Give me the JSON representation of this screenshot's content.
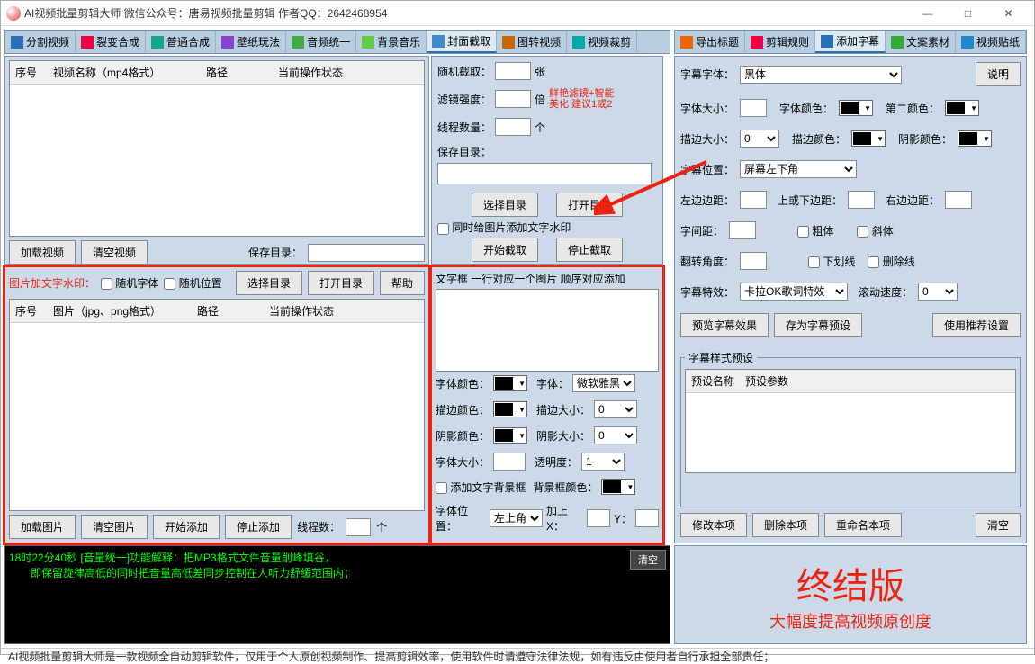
{
  "window": {
    "title": "AI视频批量剪辑大师   微信公众号：唐易视频批量剪辑   作者QQ：2642468954",
    "min": "—",
    "max": "□",
    "close": "✕"
  },
  "tabs_left": [
    {
      "label": "分割视频",
      "icon": "blue"
    },
    {
      "label": "裂变合成",
      "icon": "red"
    },
    {
      "label": "普通合成",
      "icon": "play"
    },
    {
      "label": "壁纸玩法",
      "icon": "purple"
    },
    {
      "label": "音频统一",
      "icon": "green"
    },
    {
      "label": "背景音乐",
      "icon": "music"
    },
    {
      "label": "封面截取",
      "icon": "crop",
      "active": true
    },
    {
      "label": "图转视频",
      "icon": "img"
    },
    {
      "label": "视频裁剪",
      "icon": "cut"
    }
  ],
  "tabs_right": [
    {
      "label": "导出标题",
      "icon": "export"
    },
    {
      "label": "剪辑规则",
      "icon": "rule"
    },
    {
      "label": "添加字幕",
      "icon": "sub",
      "active": true
    },
    {
      "label": "文案素材",
      "icon": "doc"
    },
    {
      "label": "视频贴纸",
      "icon": "sticker"
    }
  ],
  "grid1": {
    "h1": "序号",
    "h2": "视频名称（mp4格式）",
    "h3": "路径",
    "h4": "当前操作状态"
  },
  "grid2": {
    "h1": "序号",
    "h2": "图片（jpg、png格式）",
    "h3": "路径",
    "h4": "当前操作状态"
  },
  "btns": {
    "loadvid": "加载视频",
    "clearvid": "清空视频",
    "savedir_lbl": "保存目录：",
    "watermark_lbl": "图片加文字水印：",
    "rnd_font": "随机字体",
    "rnd_pos": "随机位置",
    "choosedir": "选择目录",
    "opendir": "打开目录",
    "help": "帮助",
    "loadimg": "加载图片",
    "clearimg": "清空图片",
    "startadd": "开始添加",
    "stopadd": "停止添加",
    "threads_lbl": "线程数：",
    "threads_unit": "个"
  },
  "cover": {
    "rand_lbl": "随机截取：",
    "rand_unit": "张",
    "filter_lbl": "滤镜强度：",
    "filter_unit": "倍",
    "filter_tip": "鲜艳滤镜+智能\n美化 建议1或2",
    "thread_lbl": "线程数量：",
    "thread_unit": "个",
    "save_lbl": "保存目录：",
    "choose": "选择目录",
    "open": "打开目录",
    "addwm": "同时给图片添加文字水印",
    "start": "开始截取",
    "stop": "停止截取",
    "textbox_lbl": "文字框 一行对应一个图片 顺序对应添加",
    "fontcolor": "字体颜色：",
    "font": "字体：",
    "font_val": "微软雅黑",
    "strokecolor": "描边颜色：",
    "strokesize": "描边大小：",
    "strokesize_v": "0",
    "shadowcolor": "阴影颜色：",
    "shadowsize": "阴影大小：",
    "shadowsize_v": "0",
    "fontsize": "字体大小：",
    "opacity": "透明度：",
    "opacity_v": "1",
    "addbg": "添加文字背景框",
    "bgcolor": "背景框颜色：",
    "pos": "字体位置：",
    "pos_v": "左上角",
    "addx": "加上X：",
    "y": "Y："
  },
  "right": {
    "explain": "说明",
    "font_lbl": "字幕字体：",
    "font_val": "黑体",
    "size_lbl": "字体大小：",
    "fontcolor_lbl": "字体颜色：",
    "color2_lbl": "第二颜色：",
    "stroke_lbl": "描边大小：",
    "stroke_v": "0",
    "strokecolor_lbl": "描边颜色：",
    "shadowcolor_lbl": "阴影颜色：",
    "pos_lbl": "字幕位置：",
    "pos_val": "屏幕左下角",
    "lmargin": "左边边距：",
    "tbmargin": "上或下边距：",
    "rmargin": "右边边距：",
    "spacing": "字间距：",
    "bold": "粗体",
    "italic": "斜体",
    "rotate": "翻转角度：",
    "underline": "下划线",
    "strikeout": "删除线",
    "fx_lbl": "字幕特效：",
    "fx_val": "卡拉OK歌词特效",
    "scroll_lbl": "滚动速度：",
    "scroll_v": "0",
    "preview": "预览字幕效果",
    "savepreset": "存为字幕预设",
    "userec": "使用推荐设置",
    "preset_legend": "字幕样式预设",
    "preset_h1": "预设名称",
    "preset_h2": "预设参数",
    "modify": "修改本项",
    "delete": "删除本项",
    "rename": "重命名本项",
    "clear": "清空"
  },
  "log": {
    "l1": "18时22分40秒 [音量统一]功能解释：把MP3格式文件音量削峰填谷，",
    "l2": "　　即保留旋律高低的同时把音量高低差同步控制在人听力舒缓范围内；",
    "clear": "清空"
  },
  "brand": {
    "big": "终结版",
    "sm": "大幅度提高视频原创度"
  },
  "footer": "AI视频批量剪辑大师是一款视频全自动剪辑软件，仅用于个人原创视频制作、提高剪辑效率，使用软件时请遵守法律法规，如有违反由使用者自行承担全部责任；"
}
